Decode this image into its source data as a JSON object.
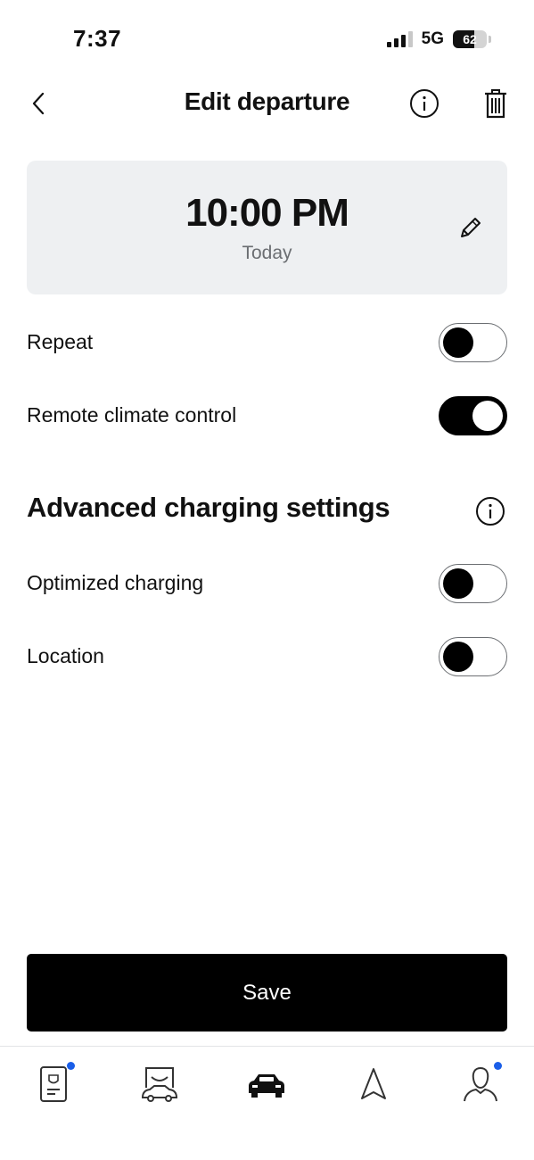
{
  "status_bar": {
    "time": "7:37",
    "network": "5G",
    "battery": "62",
    "battery_level": 0.62
  },
  "header": {
    "title": "Edit departure",
    "back_icon": "chevron-left-icon",
    "info_icon": "info-icon",
    "delete_icon": "trash-icon"
  },
  "departure": {
    "time": "10:00 PM",
    "day": "Today",
    "edit_icon": "pencil-icon"
  },
  "settings": [
    {
      "label": "Repeat",
      "enabled": false
    },
    {
      "label": "Remote climate control",
      "enabled": true
    }
  ],
  "advanced": {
    "title": "Advanced charging settings",
    "info_icon": "info-icon",
    "items": [
      {
        "label": "Optimized charging",
        "enabled": false
      },
      {
        "label": "Location",
        "enabled": false
      }
    ]
  },
  "actions": {
    "save_label": "Save"
  },
  "tabbar": {
    "tabs": [
      {
        "icon": "vehicle-card-icon",
        "active": false,
        "badge": true
      },
      {
        "icon": "car-shop-icon",
        "active": false,
        "badge": false
      },
      {
        "icon": "car-icon",
        "active": true,
        "badge": false
      },
      {
        "icon": "navigation-arrow-icon",
        "active": false,
        "badge": false
      },
      {
        "icon": "profile-icon",
        "active": false,
        "badge": true
      }
    ]
  },
  "colors": {
    "accent": "#000000",
    "card_background": "#eef0f2",
    "badge": "#1a5ee8",
    "muted_text": "#6b6e72"
  }
}
